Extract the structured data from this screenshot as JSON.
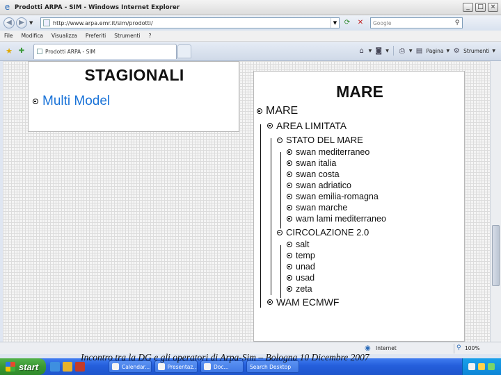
{
  "window": {
    "title": "Prodotti ARPA - SIM - Windows Internet Explorer",
    "minimize": "_",
    "maximize": "□",
    "close": "×"
  },
  "address": {
    "url": "http://www.arpa.emr.it/sim/prodotti/",
    "search_placeholder": "Google"
  },
  "menu": {
    "items": [
      "File",
      "Modifica",
      "Visualizza",
      "Preferiti",
      "Strumenti",
      "?"
    ]
  },
  "tabs": {
    "active_label": "Prodotti ARPA - SIM"
  },
  "toolbar": {
    "page_label": "Pagina",
    "tools_label": "Strumenti"
  },
  "left_panel": {
    "title": "STAGIONALI",
    "link": "Multi Model"
  },
  "right_panel": {
    "title": "MARE",
    "tree": {
      "root": "MARE",
      "area_limitata": "AREA LIMITATA",
      "stato_del_mare": "STATO DEL MARE",
      "stato_items": [
        "swan mediterraneo",
        "swan italia",
        "swan costa",
        "swan adriatico",
        "swan emilia-romagna",
        "swan marche",
        "wam lami mediterraneo"
      ],
      "circolazione": "CIRCOLAZIONE 2.0",
      "circolazione_items": [
        "salt",
        "temp",
        "unad",
        "usad",
        "zeta"
      ],
      "wam_ecmwf": "WAM ECMWF"
    }
  },
  "status": {
    "zone": "Internet",
    "zoom": "100%"
  },
  "taskbar": {
    "start": "start",
    "tasks": [
      "Calendar...",
      "Presentaz...",
      "Doc...",
      "Search Desktop"
    ]
  },
  "caption": "Incontro tra la DG e gli operatori di Arpa-Sim – Bologna 10 Dicembre 2007",
  "colors": {
    "link": "#1a73d8",
    "taskbar": "#245edb",
    "start": "#3b9833"
  }
}
